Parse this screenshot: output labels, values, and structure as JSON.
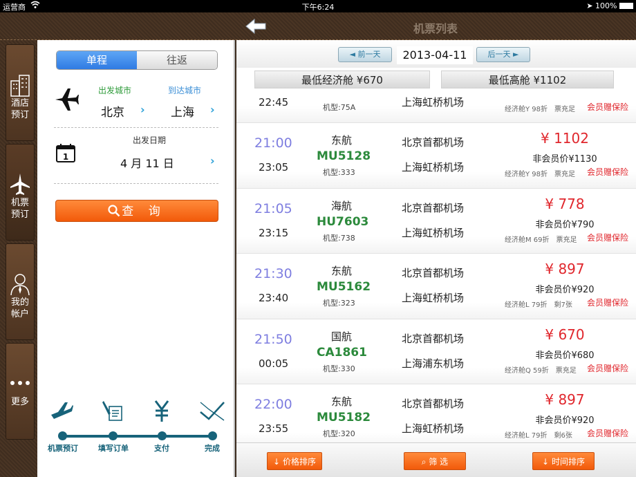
{
  "status": {
    "carrier": "运营商",
    "time": "下午6:24",
    "battery": "100%"
  },
  "header": {
    "title": "机票列表"
  },
  "sidebar": {
    "items": [
      {
        "label1": "酒店",
        "label2": "预订",
        "icon": "hotel-icon"
      },
      {
        "label1": "机票",
        "label2": "预订",
        "icon": "airplane-icon"
      },
      {
        "label1": "我的",
        "label2": "帐户",
        "icon": "user-icon"
      },
      {
        "label1": "更多",
        "label2": "",
        "icon": "more-icon"
      }
    ]
  },
  "search": {
    "oneway": "单程",
    "roundtrip": "往返",
    "depart_label": "出发城市",
    "arrive_label": "到达城市",
    "depart_city": "北京",
    "arrive_city": "上海",
    "date_label": "出发日期",
    "date_value": "4 月 11 日",
    "search_button": "查 询"
  },
  "steps": [
    "机票预订",
    "填写订单",
    "支付",
    "完成"
  ],
  "datebar": {
    "prev": "前一天",
    "date": "2013-04-11",
    "next": "后一天"
  },
  "summary": {
    "lowest_economy": "最低经济舱 ¥670",
    "lowest_premium": "最低高舱 ¥1102"
  },
  "partial_row": {
    "arrive": "22:45",
    "model": "机型:75A",
    "to_airport": "上海虹桥机场",
    "cabin": "经济舱Y 98折　票充足",
    "promo": "会员赠保险"
  },
  "flights": [
    {
      "dep": "21:00",
      "arr": "23:05",
      "airline": "东航",
      "fno": "MU5128",
      "model": "机型:333",
      "from": "北京首都机场",
      "to": "上海虹桥机场",
      "price": "¥ 1102",
      "nonmember": "非会员价¥1130",
      "cabin": "经济舱Y 98折　票充足",
      "promo": "会员赠保险"
    },
    {
      "dep": "21:05",
      "arr": "23:15",
      "airline": "海航",
      "fno": "HU7603",
      "model": "机型:738",
      "from": "北京首都机场",
      "to": "上海虹桥机场",
      "price": "¥ 778",
      "nonmember": "非会员价¥790",
      "cabin": "经济舱M 69折　票充足",
      "promo": "会员赠保险"
    },
    {
      "dep": "21:30",
      "arr": "23:40",
      "airline": "东航",
      "fno": "MU5162",
      "model": "机型:323",
      "from": "北京首都机场",
      "to": "上海虹桥机场",
      "price": "¥ 897",
      "nonmember": "非会员价¥920",
      "cabin": "经济舱L 79折　剩7张",
      "promo": "会员赠保险"
    },
    {
      "dep": "21:50",
      "arr": "00:05",
      "airline": "国航",
      "fno": "CA1861",
      "model": "机型:330",
      "from": "北京首都机场",
      "to": "上海浦东机场",
      "price": "¥ 670",
      "nonmember": "非会员价¥680",
      "cabin": "经济舱Q 59折　票充足",
      "promo": "会员赠保险"
    },
    {
      "dep": "22:00",
      "arr": "23:55",
      "airline": "东航",
      "fno": "MU5182",
      "model": "机型:320",
      "from": "北京首都机场",
      "to": "上海虹桥机场",
      "price": "¥ 897",
      "nonmember": "非会员价¥920",
      "cabin": "经济舱L 79折　剩6张",
      "promo": "会员赠保险"
    }
  ],
  "bottom": {
    "price_sort": "价格排序",
    "filter": "筛 选",
    "time_sort": "时间排序"
  },
  "colors": {
    "accent_orange": "#f25a0a",
    "price_red": "#e0262c",
    "flight_green": "#2c8a3c",
    "step_teal": "#17637a"
  }
}
